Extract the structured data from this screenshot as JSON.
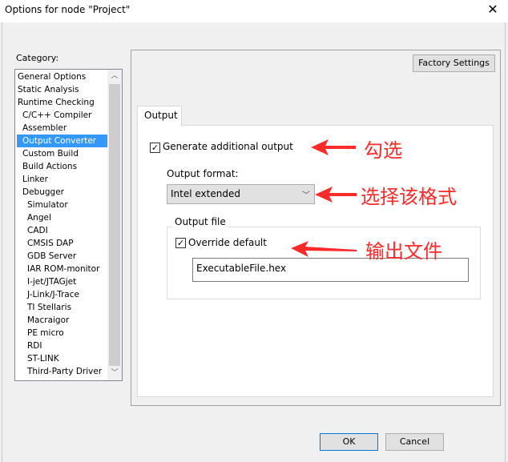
{
  "window": {
    "title": "Options for node \"Project\"",
    "close_icon": "close-icon"
  },
  "category": {
    "label": "Category:",
    "selected": "Output Converter",
    "items": [
      {
        "label": "General Options",
        "level": 0
      },
      {
        "label": "Static Analysis",
        "level": 0
      },
      {
        "label": "Runtime Checking",
        "level": 0
      },
      {
        "label": "C/C++ Compiler",
        "level": 1
      },
      {
        "label": "Assembler",
        "level": 1
      },
      {
        "label": "Output Converter",
        "level": 1
      },
      {
        "label": "Custom Build",
        "level": 1
      },
      {
        "label": "Build Actions",
        "level": 1
      },
      {
        "label": "Linker",
        "level": 1
      },
      {
        "label": "Debugger",
        "level": 1
      },
      {
        "label": "Simulator",
        "level": 2
      },
      {
        "label": "Angel",
        "level": 2
      },
      {
        "label": "CADI",
        "level": 2
      },
      {
        "label": "CMSIS DAP",
        "level": 2
      },
      {
        "label": "GDB Server",
        "level": 2
      },
      {
        "label": "IAR ROM-monitor",
        "level": 2
      },
      {
        "label": "I-jet/JTAGjet",
        "level": 2
      },
      {
        "label": "J-Link/J-Trace",
        "level": 2
      },
      {
        "label": "TI Stellaris",
        "level": 2
      },
      {
        "label": "Macraigor",
        "level": 2
      },
      {
        "label": "PE micro",
        "level": 2
      },
      {
        "label": "RDI",
        "level": 2
      },
      {
        "label": "ST-LINK",
        "level": 2
      },
      {
        "label": "Third-Party Driver",
        "level": 2
      }
    ]
  },
  "factory_settings": "Factory Settings",
  "tab": "Output",
  "generate": {
    "label": "Generate additional output",
    "checked": true
  },
  "format": {
    "label": "Output format:",
    "value": "Intel extended"
  },
  "output_file": {
    "legend": "Output file",
    "override_label": "Override default",
    "override_checked": true,
    "value": "ExecutableFile.hex"
  },
  "annotations": {
    "a1": "勾选",
    "a2": "选择该格式",
    "a3": "输出文件",
    "color": "#ff2a2a"
  },
  "buttons": {
    "ok": "OK",
    "cancel": "Cancel"
  }
}
